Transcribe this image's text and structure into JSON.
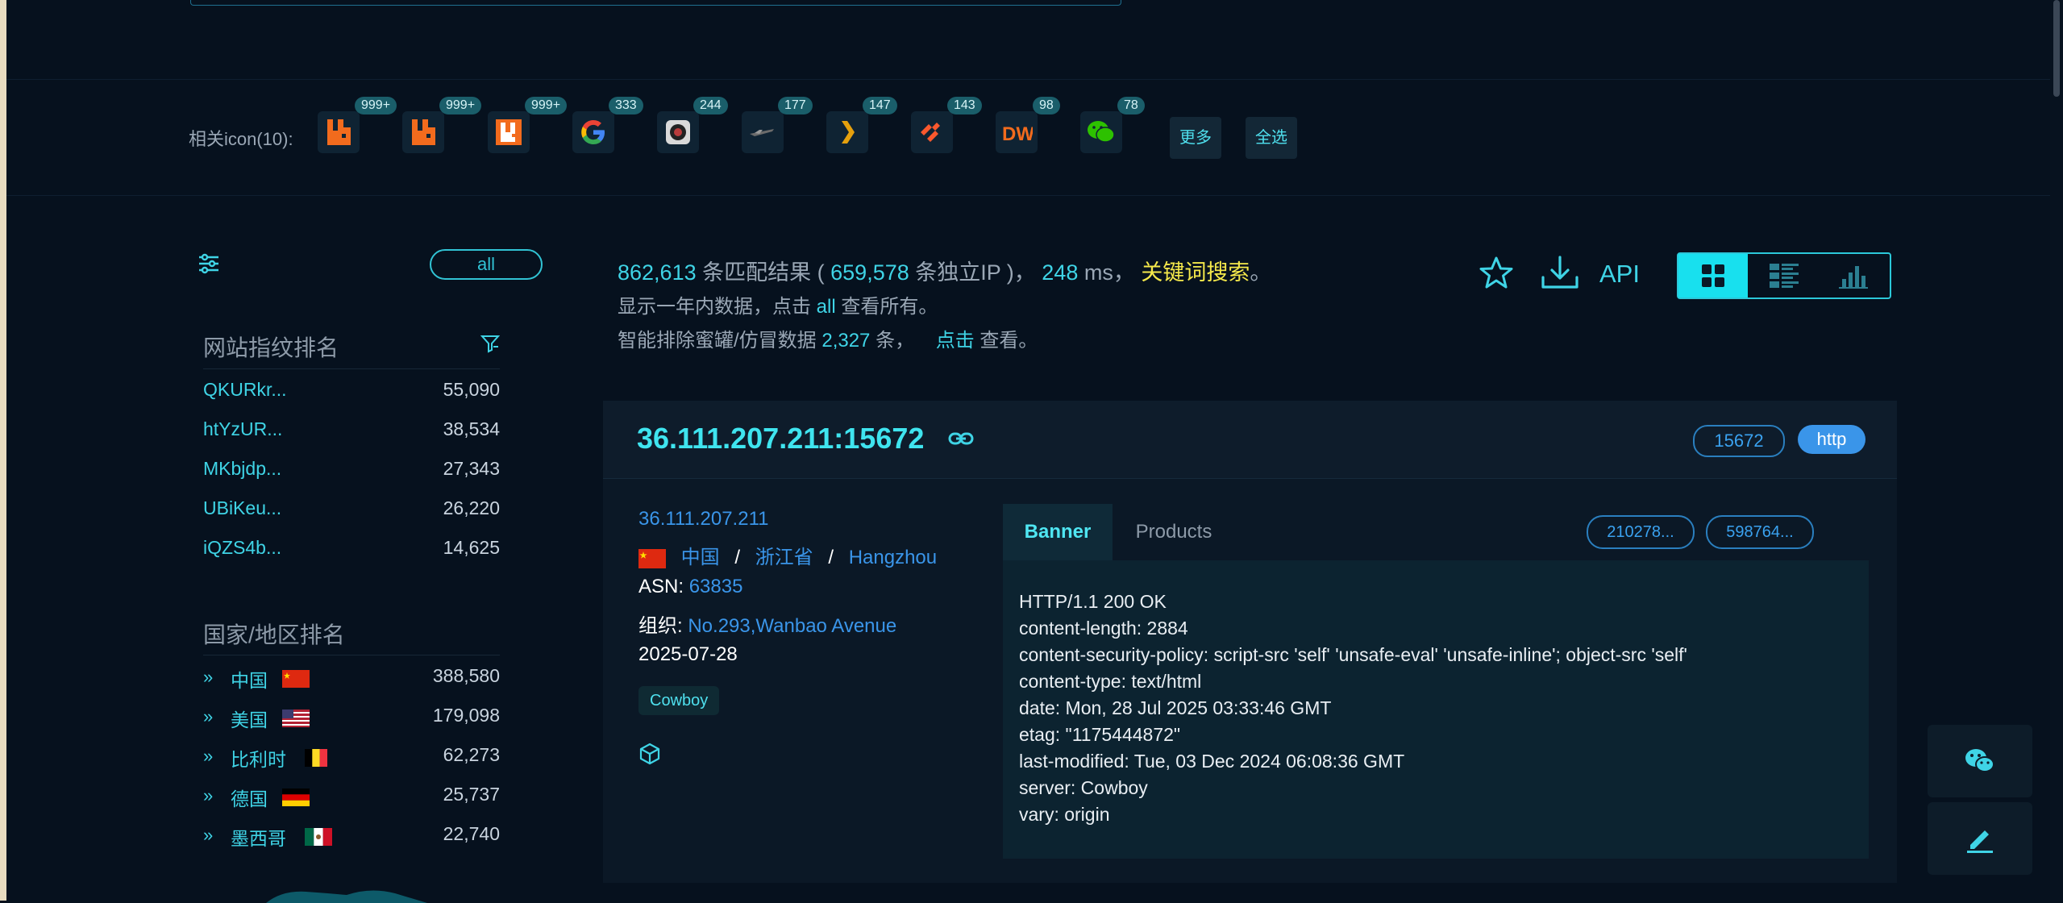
{
  "icons_bar": {
    "label": "相关icon(10):",
    "items": [
      {
        "name": "rabbitmq-icon",
        "count": "999+"
      },
      {
        "name": "rabbitmq-icon",
        "count": "999+"
      },
      {
        "name": "rabbitmq-icon",
        "count": "999+"
      },
      {
        "name": "google-icon",
        "count": "333"
      },
      {
        "name": "camera-icon",
        "count": "244"
      },
      {
        "name": "plane-icon",
        "count": "177"
      },
      {
        "name": "plex-icon",
        "count": "147"
      },
      {
        "name": "paloalto-icon",
        "count": "143"
      },
      {
        "name": "dw-icon",
        "count": "98"
      },
      {
        "name": "wechat-icon",
        "count": "78"
      }
    ],
    "more_label": "更多",
    "select_all_label": "全选"
  },
  "sidebar": {
    "all_label": "all",
    "fingerprint_title": "网站指纹排名",
    "fingerprints": [
      {
        "name": "QKURkr...",
        "value": "55,090"
      },
      {
        "name": "htYzUR...",
        "value": "38,534"
      },
      {
        "name": "MKbjdp...",
        "value": "27,343"
      },
      {
        "name": "UBiKeu...",
        "value": "26,220"
      },
      {
        "name": "iQZS4b...",
        "value": "14,625"
      }
    ],
    "country_title": "国家/地区排名",
    "countries": [
      {
        "name": "中国",
        "value": "388,580",
        "flag": "cn"
      },
      {
        "name": "美国",
        "value": "179,098",
        "flag": "us"
      },
      {
        "name": "比利时",
        "value": "62,273",
        "flag": "be"
      },
      {
        "name": "德国",
        "value": "25,737",
        "flag": "de"
      },
      {
        "name": "墨西哥",
        "value": "22,740",
        "flag": "mx"
      }
    ]
  },
  "summary": {
    "total": "862,613",
    "total_suffix": "条匹配结果 (",
    "unique_ip": "659,578",
    "unique_suffix": "条独立IP )，",
    "time": "248",
    "time_suffix": "ms，",
    "keyword_search": "关键词搜索",
    "end": "。",
    "line2_a": "显示一年内数据，点击",
    "line2_all": "all",
    "line2_b": "查看所有。",
    "line3_a": "智能排除蜜罐/仿冒数据",
    "line3_num": "2,327",
    "line3_b": "条，",
    "line3_click": "点击",
    "line3_c": "查看。"
  },
  "toolbar": {
    "api_label": "API"
  },
  "result": {
    "title": "36.111.207.211:15672",
    "port_tag": "15672",
    "protocol_tag": "http",
    "ip": "36.111.207.211",
    "country": "中国",
    "province": "浙江省",
    "city": "Hangzhou",
    "asn_label": "ASN:",
    "asn": "63835",
    "org_label": "组织:",
    "org": "No.293,Wanbao Avenue",
    "date": "2025-07-28",
    "server_tag": "Cowboy",
    "tab_banner": "Banner",
    "tab_products": "Products",
    "hash1": "210278...",
    "hash2": "598764...",
    "banner_lines": [
      "HTTP/1.1 200 OK",
      "content-length: 2884",
      "content-security-policy: script-src 'self' 'unsafe-eval' 'unsafe-inline'; object-src 'self'",
      "content-type: text/html",
      "date: Mon, 28 Jul 2025 03:33:46 GMT",
      "etag: \"1175444872\"",
      "last-modified: Tue, 03 Dec 2024 06:08:36 GMT",
      "server: Cowboy",
      "vary: origin"
    ]
  },
  "colors": {
    "accent": "#3fd4e6",
    "keyword": "#f5e94b",
    "link_blue": "#3a95e9",
    "background": "#06111e"
  }
}
